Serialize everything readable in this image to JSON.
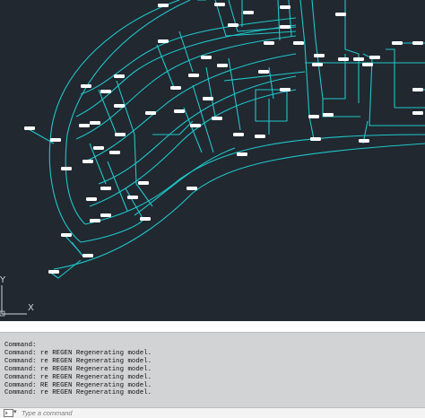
{
  "ucs": {
    "y_label": "Y",
    "x_label": "X"
  },
  "command_history": [
    "Command:",
    "Command: re REGEN Regenerating model.",
    "Command: re REGEN Regenerating model.",
    "Command: re REGEN Regenerating model.",
    "Command: re REGEN Regenerating model.",
    "Command: RE REGEN Regenerating model.",
    "Command: re REGEN Regenerating model."
  ],
  "command_input": {
    "placeholder": "Type a command"
  },
  "colors": {
    "background": "#212830",
    "linework": "#1fc6c9",
    "tag_fill": "#ffffff",
    "command_panel": "#d2d3d5"
  },
  "icons": {
    "command_line": "command-prompt-icon",
    "ucs": "ucs-axis-icon"
  }
}
